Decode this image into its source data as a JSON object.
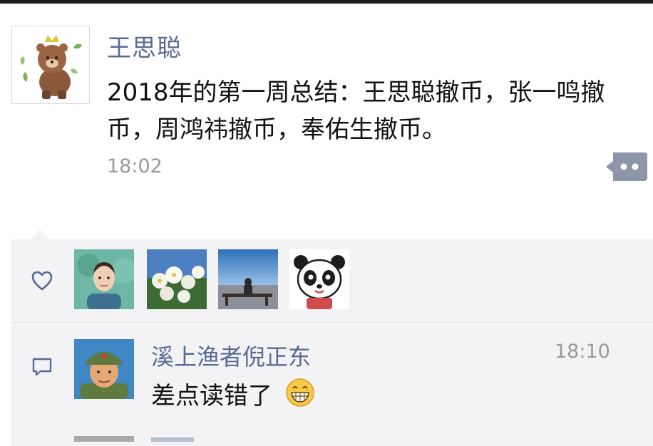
{
  "post": {
    "username": "王思聪",
    "text": "2018年的第一周总结：王思聪撤币，张一鸣撤币，周鸿祎撤币，奉佑生撤币。",
    "time": "18:02",
    "more_icon": "ellipsis-bubble-icon"
  },
  "likes": {
    "icon": "heart-icon",
    "avatars": [
      "man-portrait",
      "white-flowers",
      "bench-by-sea",
      "panda-cartoon"
    ]
  },
  "comments": [
    {
      "icon": "comment-bubble-icon",
      "author": "溪上渔者倪正东",
      "time": "18:10",
      "text": "差点读错了",
      "emoji": "grinning-face-emoji"
    }
  ],
  "colors": {
    "name_link": "#576b95",
    "panel_bg": "#f3f3f5",
    "time_gray": "#9a9a9a",
    "text": "#111111"
  }
}
